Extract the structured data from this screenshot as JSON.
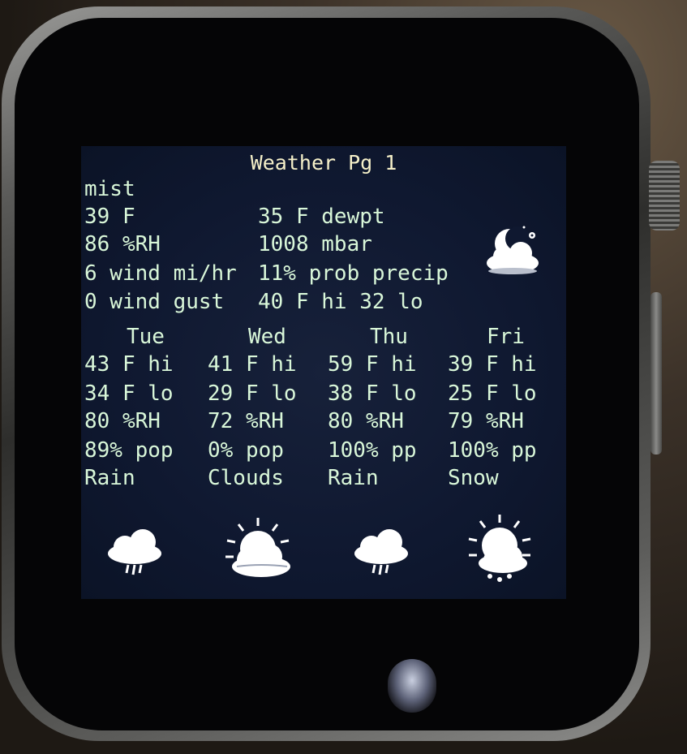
{
  "screen": {
    "title": "Weather Pg 1",
    "condition": "mist",
    "current": {
      "temp": "39 F",
      "dewpoint": "35 F dewpt",
      "humidity": "86 %RH",
      "pressure": "1008 mbar",
      "wind": "6 wind mi/hr",
      "precip_prob": "11% prob precip",
      "gust": "0 wind gust",
      "hi_lo": "40 F hi 32 lo",
      "icon": "moon-cloud-icon"
    },
    "forecast": [
      {
        "day": "Tue",
        "hi": "43 F hi",
        "lo": "34 F lo",
        "rh": "80 %RH",
        "pop": "89% pop",
        "desc": "Rain",
        "icon": "rain-cloud-icon"
      },
      {
        "day": "Wed",
        "hi": "41 F hi",
        "lo": "29 F lo",
        "rh": "72 %RH",
        "pop": "0% pop",
        "desc": "Clouds",
        "icon": "sun-cloud-icon"
      },
      {
        "day": "Thu",
        "hi": "59 F hi",
        "lo": "38 F lo",
        "rh": "80 %RH",
        "pop": "100% pp",
        "desc": "Rain",
        "icon": "rain-cloud-icon"
      },
      {
        "day": "Fri",
        "hi": "39 F hi",
        "lo": "25 F lo",
        "rh": "79 %RH",
        "pop": "100% pp",
        "desc": "Snow",
        "icon": "snow-sun-cloud-icon"
      }
    ]
  },
  "colors": {
    "screen_bg": "#0f1830",
    "text": "#d9f7d9",
    "title": "#f5f0c9"
  }
}
